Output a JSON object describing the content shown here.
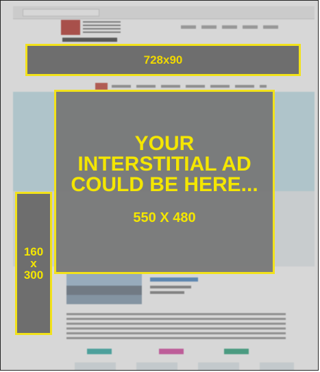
{
  "ads": {
    "banner": {
      "label": "728x90"
    },
    "skyscraper": {
      "line1": "160",
      "line2": "x",
      "line3": "300"
    },
    "interstitial": {
      "line1": "YOUR",
      "line2": "INTERSTITIAL AD",
      "line3": "COULD BE HERE...",
      "size": "550 X 480"
    }
  },
  "colors": {
    "ad_border": "#f2e21a",
    "ad_text": "#f4e600",
    "ad_fill": "#6e6e6e",
    "brand_red": "#b3261e"
  }
}
